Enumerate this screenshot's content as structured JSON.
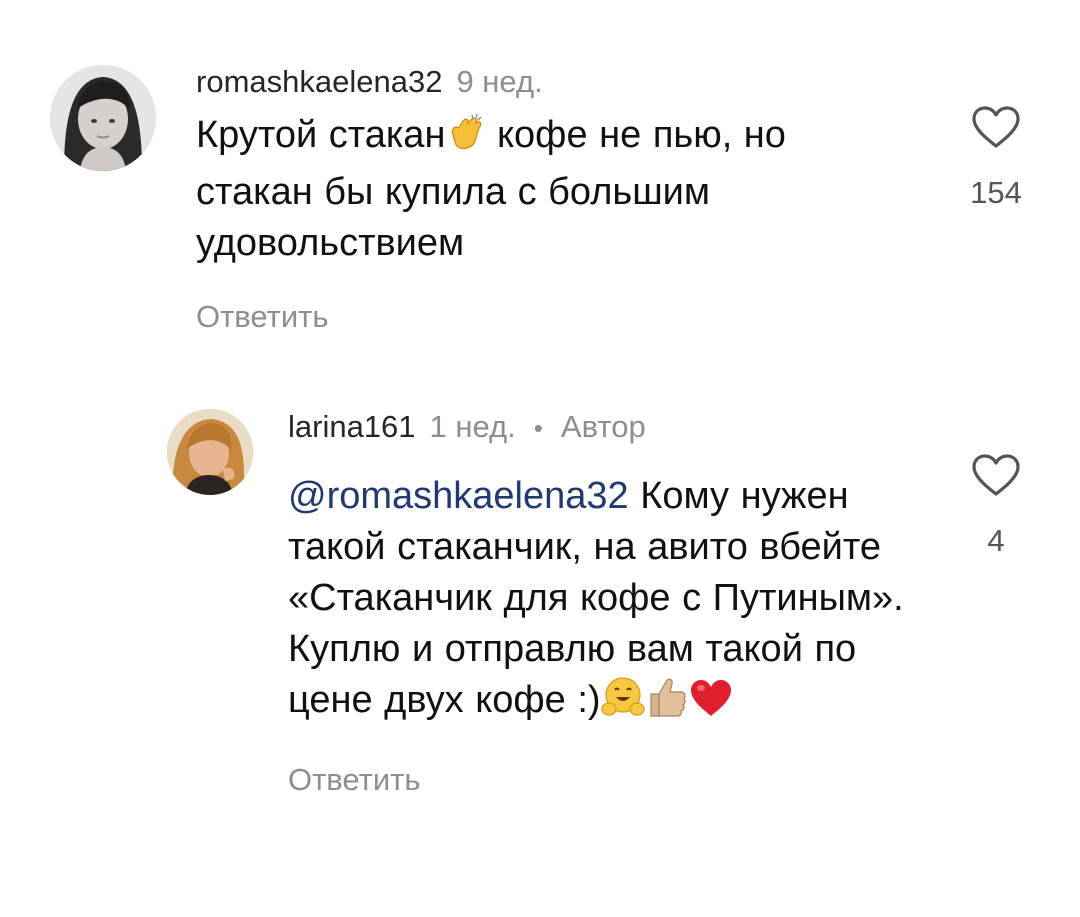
{
  "comments": [
    {
      "username": "romashkaelena32",
      "time": "9 нед.",
      "text_part1": "Крутой стакан",
      "text_part2": " кофе не пью, но стакан бы купила с большим удовольствием",
      "emoji": "clapping-hands-icon",
      "reply_label": "Ответить",
      "like_count": "154",
      "avatar": "avatar-girl-photo"
    },
    {
      "username": "larina161",
      "time": "1 нед.",
      "separator": "•",
      "author_badge": "Автор",
      "mention": "@romashkaelena32",
      "text": " Кому нужен такой стаканчик, на авито вбейте «Стаканчик для кофе с Путиным». Куплю и отправлю вам такой по цене двух кофе :)",
      "emojis": [
        "hugging-face-icon",
        "thumbs-up-icon",
        "red-heart-icon"
      ],
      "reply_label": "Ответить",
      "like_count": "4",
      "avatar": "avatar-woman-photo"
    }
  ],
  "colors": {
    "text": "#111111",
    "muted": "#8e8e8e",
    "mention": "#1f3a72",
    "heart_emoji": "#e0202e"
  }
}
